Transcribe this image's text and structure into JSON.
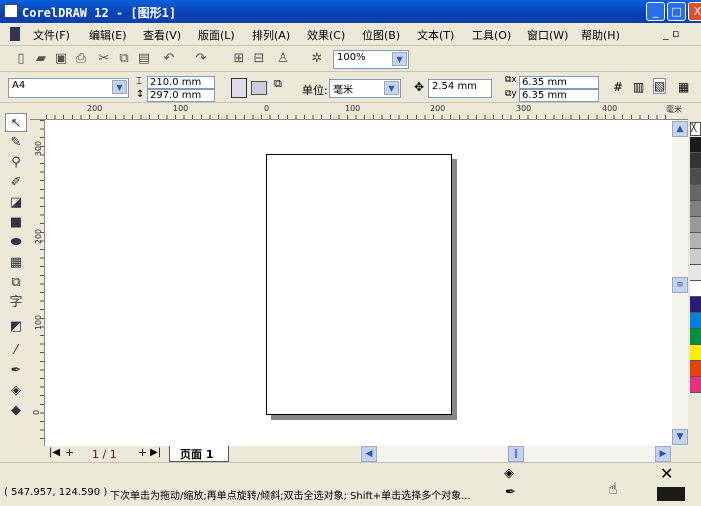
{
  "window": {
    "title": "CorelDRAW 12 - [图形1]"
  },
  "menu": [
    "文件(F)",
    "编辑(E)",
    "查看(V)",
    "版面(L)",
    "排列(A)",
    "效果(C)",
    "位图(B)",
    "文本(T)",
    "工具(O)",
    "窗口(W)",
    "帮助(H)"
  ],
  "toolbar": {
    "zoom": "100%"
  },
  "propbar": {
    "paper": "A4",
    "width": "210.0 mm",
    "height": "297.0 mm",
    "unit_label": "单位:",
    "unit": "毫米",
    "nudge": "2.54 mm",
    "dup_x": "6.35 mm",
    "dup_y": "6.35 mm"
  },
  "ruler": {
    "h_ticks": [
      "200",
      "100",
      "0",
      "100",
      "200",
      "300",
      "400"
    ],
    "v_ticks": [
      "300",
      "200",
      "100",
      "0"
    ],
    "unit": "毫米"
  },
  "pagenav": {
    "count": "1 / 1",
    "tab": "页面 1"
  },
  "status": {
    "coords": "( 547.957, 124.590 )",
    "hint": "下次单击为拖动/缩放;再单点旋转/倾斜;双击全选对象; Shift+单击选择多个对象..."
  },
  "palette": [
    "#1a1a1a",
    "#333333",
    "#4d4d4d",
    "#666666",
    "#808080",
    "#999999",
    "#b3b3b3",
    "#cccccc",
    "#e6e6e6",
    "#ffffff",
    "#2a1a7a",
    "#0080e0",
    "#009040",
    "#ffee00",
    "#e84010",
    "#e83080"
  ],
  "icons": [
    "select",
    "shape",
    "zoom",
    "freehand",
    "smart-fill",
    "rectangle",
    "ellipse",
    "graph-paper",
    "basic-shapes",
    "text",
    "interactive-blend",
    "eyedropper",
    "outline",
    "fill",
    "interactive-fill"
  ]
}
